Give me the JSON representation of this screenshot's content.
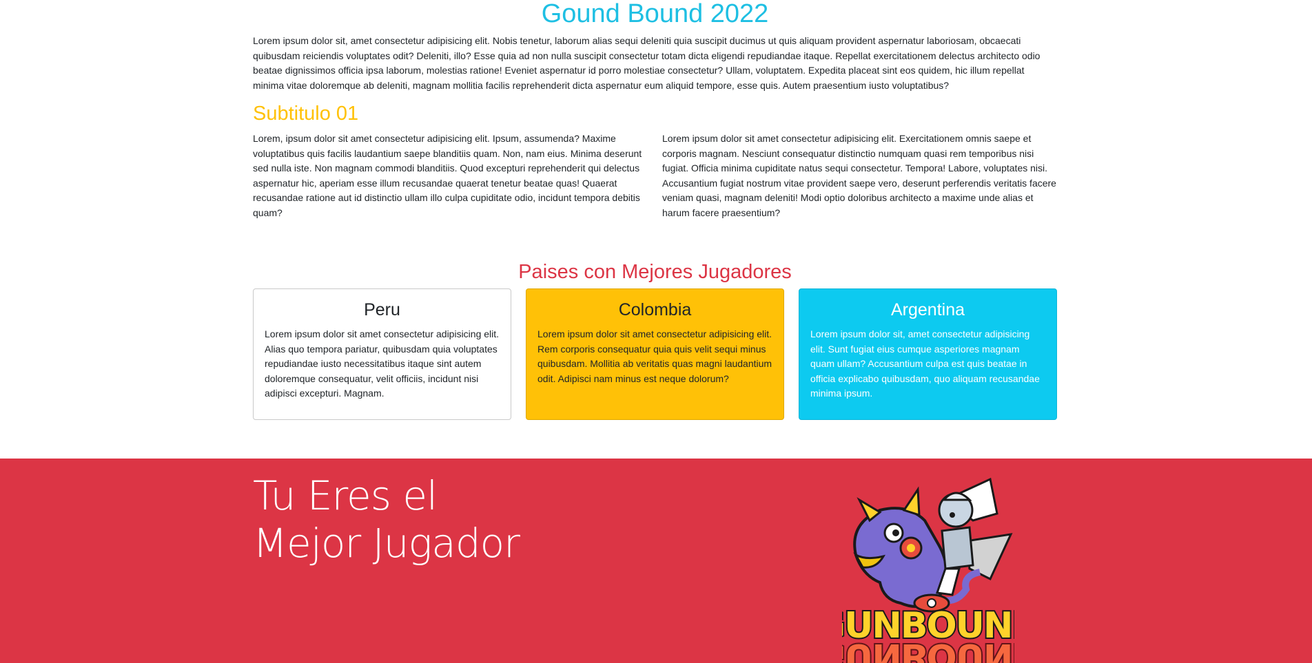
{
  "header": {
    "title": "Gound Bound 2022",
    "intro": "Lorem ipsum dolor sit, amet consectetur adipisicing elit. Nobis tenetur, laborum alias sequi deleniti quia suscipit ducimus ut quis aliquam provident aspernatur laboriosam, obcaecati quibusdam reiciendis voluptates odit? Deleniti, illo? Esse quia ad non nulla suscipit consectetur totam dicta eligendi repudiandae itaque. Repellat exercitationem delectus architecto odio beatae dignissimos officia ipsa laborum, molestias ratione! Eveniet aspernatur id porro molestiae consectetur? Ullam, voluptatem. Expedita placeat sint eos quidem, hic illum repellat minima vitae doloremque ab deleniti, magnam mollitia facilis reprehenderit dicta aspernatur eum aliquid tempore, esse quis. Autem praesentium iusto voluptatibus?"
  },
  "section1": {
    "subtitle": "Subtitulo 01",
    "left_text": "Lorem, ipsum dolor sit amet consectetur adipisicing elit. Ipsum, assumenda? Maxime voluptatibus quis facilis laudantium saepe blanditiis quam. Non, nam eius. Minima deserunt sed nulla iste. Non magnam commodi blanditiis. Quod excepturi reprehenderit qui delectus aspernatur hic, aperiam esse illum recusandae quaerat tenetur beatae quas! Quaerat recusandae ratione aut id distinctio ullam illo culpa cupiditate odio, incidunt tempora debitis quam?",
    "right_text": "Lorem ipsum dolor sit amet consectetur adipisicing elit. Exercitationem omnis saepe et corporis magnam. Nesciunt consequatur distinctio numquam quasi rem temporibus nisi fugiat. Officia minima cupiditate natus sequi consectetur. Tempora! Labore, voluptates nisi. Accusantium fugiat nostrum vitae provident saepe vero, deserunt perferendis veritatis facere veniam quasi, magnam deleniti! Modi optio doloribus architecto a maxime unde alias et harum facere praesentium?"
  },
  "countries": {
    "title": "Paises con Mejores Jugadores",
    "cards": [
      {
        "name": "Peru",
        "text": "Lorem ipsum dolor sit amet consectetur adipisicing elit. Alias quo tempora pariatur, quibusdam quia voluptates repudiandae iusto necessitatibus itaque sint autem doloremque consequatur, velit officiis, incidunt nisi adipisci excepturi. Magnam.",
        "color": "#ffffff"
      },
      {
        "name": "Colombia",
        "text": "Lorem ipsum dolor sit amet consectetur adipisicing elit. Rem corporis consequatur quia quis velit sequi minus quibusdam. Mollitia ab veritatis quas magni laudantium odit. Adipisci nam minus est neque dolorum?",
        "color": "#ffc107"
      },
      {
        "name": "Argentina",
        "text": "Lorem ipsum dolor sit, amet consectetur adipisicing elit. Sunt fugiat eius cumque asperiores magnam quam ullam? Accusantium culpa est quis beatae in officia explicabo quibusdam, quo aliquam recusandae minima ipsum.",
        "color": "#0dcaf0"
      }
    ]
  },
  "footer": {
    "line1": "Tu Eres el",
    "line2": "Mejor Jugador",
    "logo_text": "GUNBOUND",
    "background": "#dc3545"
  },
  "colors": {
    "title": "#1ebfe3",
    "subtitle": "#ffc107",
    "section_title": "#dc3545"
  },
  "icons": {
    "logo": "gunbound-logo-icon"
  }
}
